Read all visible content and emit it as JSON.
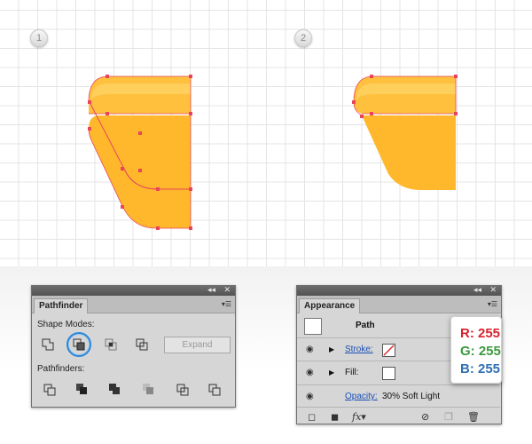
{
  "steps": {
    "one": "1",
    "two": "2"
  },
  "colors": {
    "shape_fill": "#ffb82c",
    "shape_highlight": "#ffc74e",
    "anchor": "#e8455a",
    "path_stroke": "#e8455a",
    "r_color": "#d9232e",
    "g_color": "#3b9a3d",
    "b_color": "#2f6fb2"
  },
  "pathfinder": {
    "tab_label": "Pathfinder",
    "shape_modes_label": "Shape Modes:",
    "shape_mode_icons": [
      "unite-icon",
      "minus-front-icon",
      "intersect-icon",
      "exclude-icon"
    ],
    "expand_label": "Expand",
    "pathfinders_label": "Pathfinders:",
    "pathfinder_icons": [
      "divide-icon",
      "trim-icon",
      "merge-icon",
      "crop-icon",
      "outline-icon",
      "minus-back-icon"
    ]
  },
  "appearance": {
    "tab_label": "Appearance",
    "object_label": "Path",
    "stroke_label": "Stroke:",
    "fill_label": "Fill:",
    "opacity_label": "Opacity:",
    "opacity_value": "30% Soft Light"
  },
  "rgb": {
    "r": "R: 255",
    "g": "G: 255",
    "b": "B: 255"
  }
}
